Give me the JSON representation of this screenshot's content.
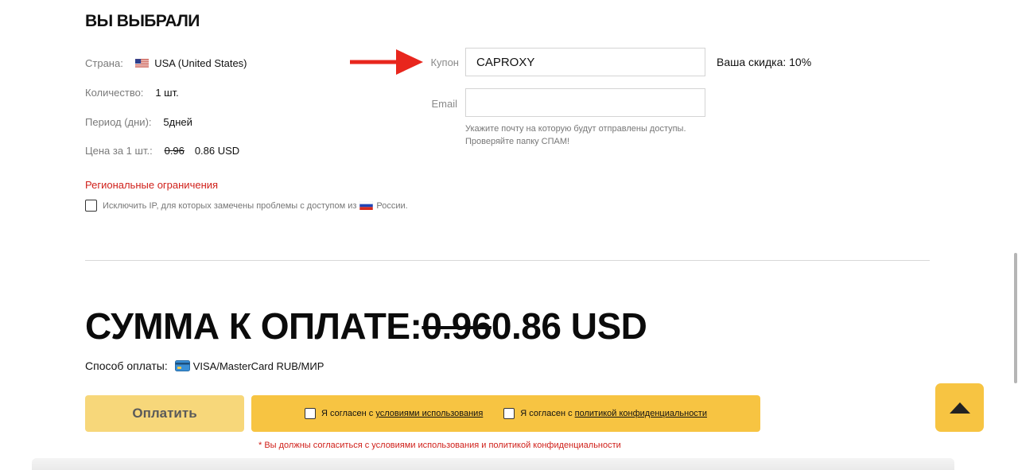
{
  "section_title": "ВЫ ВЫБРАЛИ",
  "details": {
    "country_label": "Страна:",
    "country_value": "USA (United States)",
    "quantity_label": "Количество:",
    "quantity_value": "1 шт.",
    "period_label": "Период (дни):",
    "period_value": "5дней",
    "price_label": "Цена за 1 шт.:",
    "price_old": "0.96",
    "price_new": "0.86 USD"
  },
  "regional": {
    "link": "Региональные ограничения",
    "exclude_text_before": "Исключить IP, для которых замечены проблемы с доступом из",
    "exclude_text_after": "России."
  },
  "coupon": {
    "label": "Купон",
    "value": "CAPROXY",
    "discount_text": "Ваша скидка: 10%"
  },
  "email": {
    "label": "Email",
    "value": "",
    "hint_line1": "Укажите почту на которую будут отправлены доступы.",
    "hint_line2": "Проверяйте папку СПАМ!"
  },
  "total": {
    "label": "СУММА К ОПЛАТЕ:",
    "old": "0.96",
    "new": "0.86",
    "currency": "USD"
  },
  "payment": {
    "label": "Способ оплаты:",
    "method": "VISA/MasterCard RUB/МИР",
    "method_icon": "credit-card-icon"
  },
  "actions": {
    "pay_label": "Оплатить",
    "agree_terms_prefix": "Я согласен с",
    "agree_terms_link": "условиями использования",
    "agree_privacy_prefix": "Я согласен с",
    "agree_privacy_link": "политикой конфиденциальности",
    "warning": "* Вы должны согласиться с условиями использования и политикой конфиденциальности"
  },
  "colors": {
    "accent_yellow": "#f7c442",
    "pay_button": "#f7d77a",
    "warning_red": "#d0211b",
    "arrow_red": "#e8261d"
  }
}
